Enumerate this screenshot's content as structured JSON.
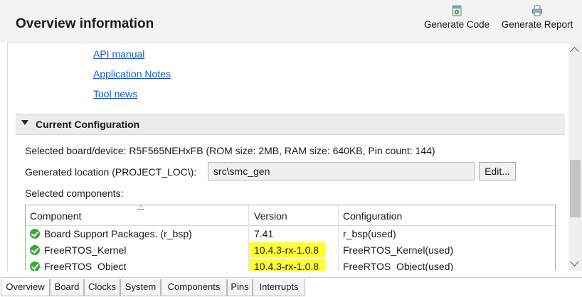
{
  "header": {
    "title": "Overview information",
    "generate_code_label": "Generate Code",
    "generate_report_label": "Generate Report"
  },
  "links": {
    "api_manual": "API manual",
    "application_notes": "Application Notes",
    "tool_news": "Tool news"
  },
  "section": {
    "title": "Current Configuration"
  },
  "config": {
    "selected_device": "Selected board/device: R5F565NEHxFB (ROM size: 2MB, RAM size: 640KB, Pin count: 144)",
    "generated_location_label": "Generated location (PROJECT_LOC\\):",
    "generated_location_value": "src\\smc_gen",
    "edit_label": "Edit...",
    "selected_components_label": "Selected components:"
  },
  "table": {
    "columns": [
      "Component",
      "Version",
      "Configuration"
    ],
    "rows": [
      {
        "component": "Board Support Packages. (r_bsp)",
        "version": "7.41",
        "configuration": "r_bsp(used)",
        "highlight": false
      },
      {
        "component": "FreeRTOS_Kernel",
        "version": "10.4.3-rx-1.0.8",
        "configuration": "FreeRTOS_Kernel(used)",
        "highlight": true
      },
      {
        "component": "FreeRTOS_Object",
        "version": "10.4.3-rx-1.0.8",
        "configuration": "FreeRTOS_Object(used)",
        "highlight": true
      }
    ]
  },
  "tabs": [
    "Overview",
    "Board",
    "Clocks",
    "System",
    "Components",
    "Pins",
    "Interrupts"
  ],
  "active_tab": "Overview",
  "colors": {
    "link": "#1a56c8",
    "highlight": "#ffff33",
    "status_ok": "#3aa83a"
  },
  "icons": {
    "generate_code": "generate-code-icon",
    "generate_report": "generate-report-icon",
    "status": "check-circle-icon"
  }
}
